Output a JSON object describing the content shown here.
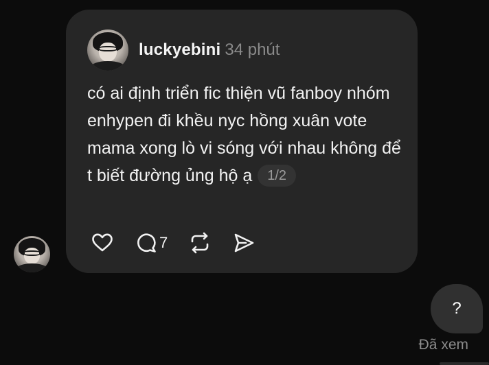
{
  "post": {
    "username": "luckyebini",
    "time": "34 phút",
    "text": "có ai định triển fic thiện vũ fanboy nhóm enhypen đi khều nyc hồng xuân vote mama xong lò vi sóng với nhau không để t biết đường ủng hộ ạ",
    "page_indicator": "1/2",
    "reply_count": "7"
  },
  "icons": {
    "like": "heart-icon",
    "reply": "comment-icon",
    "repost": "repost-icon",
    "share": "send-icon"
  },
  "message": {
    "sent_text": "?",
    "status": "Đã xem"
  },
  "colors": {
    "background": "#0c0c0c",
    "bubble": "#262626",
    "sent_bubble": "#303030",
    "muted_text": "#8a8a8a"
  }
}
